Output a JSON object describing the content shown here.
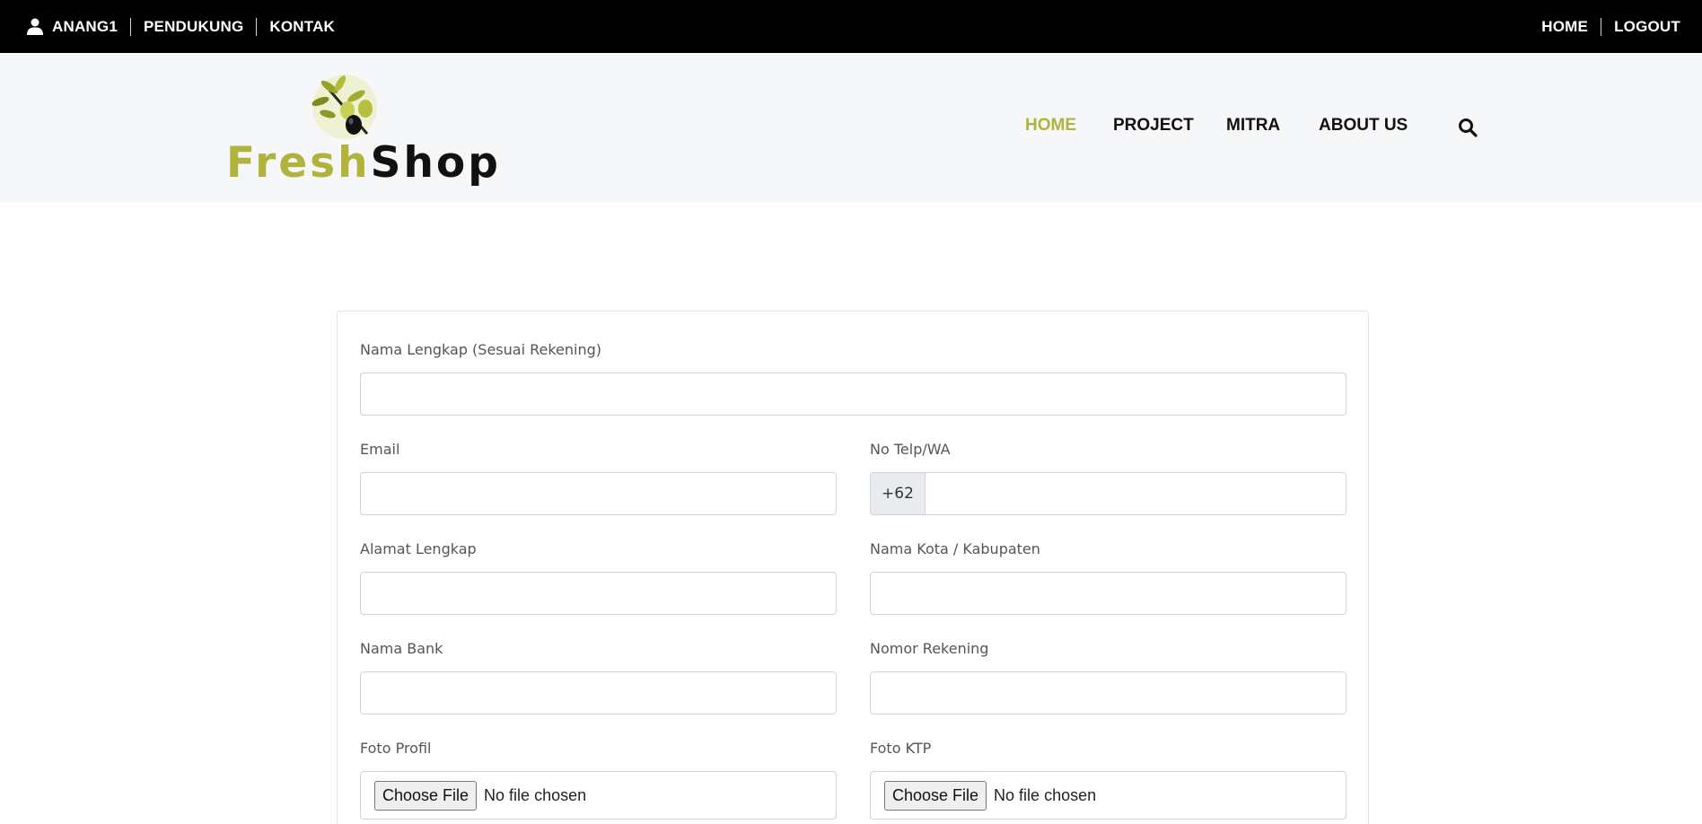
{
  "topbar": {
    "left_items": [
      {
        "label": "ANANG1",
        "icon": "user-icon"
      },
      {
        "label": "PENDUKUNG"
      },
      {
        "label": "KONTAK"
      }
    ],
    "right_items": [
      {
        "label": "HOME"
      },
      {
        "label": "LOGOUT"
      }
    ]
  },
  "header": {
    "logo": {
      "part1": "Fresh",
      "part2": "Shop"
    },
    "nav": [
      {
        "label": "HOME",
        "active": true
      },
      {
        "label": "PROJECT"
      },
      {
        "label": "MITRA"
      },
      {
        "label": "ABOUT US"
      }
    ],
    "search_icon": "search-icon"
  },
  "form": {
    "full_name": {
      "label": "Nama Lengkap (Sesuai Rekening)",
      "value": ""
    },
    "email": {
      "label": "Email",
      "value": ""
    },
    "phone": {
      "label": "No Telp/WA",
      "prefix": "+62",
      "value": ""
    },
    "address": {
      "label": "Alamat Lengkap",
      "value": ""
    },
    "city": {
      "label": "Nama Kota / Kabupaten",
      "value": ""
    },
    "bank": {
      "label": "Nama Bank",
      "value": ""
    },
    "account": {
      "label": "Nomor Rekening",
      "value": ""
    },
    "photo_profile": {
      "label": "Foto Profil",
      "button": "Choose File",
      "status": "No file chosen"
    },
    "photo_ktp": {
      "label": "Foto KTP",
      "button": "Choose File",
      "status": "No file chosen"
    }
  },
  "colors": {
    "accent": "#b0b43c",
    "topbar_bg": "#000000",
    "header_bg": "#f6f7f9"
  }
}
